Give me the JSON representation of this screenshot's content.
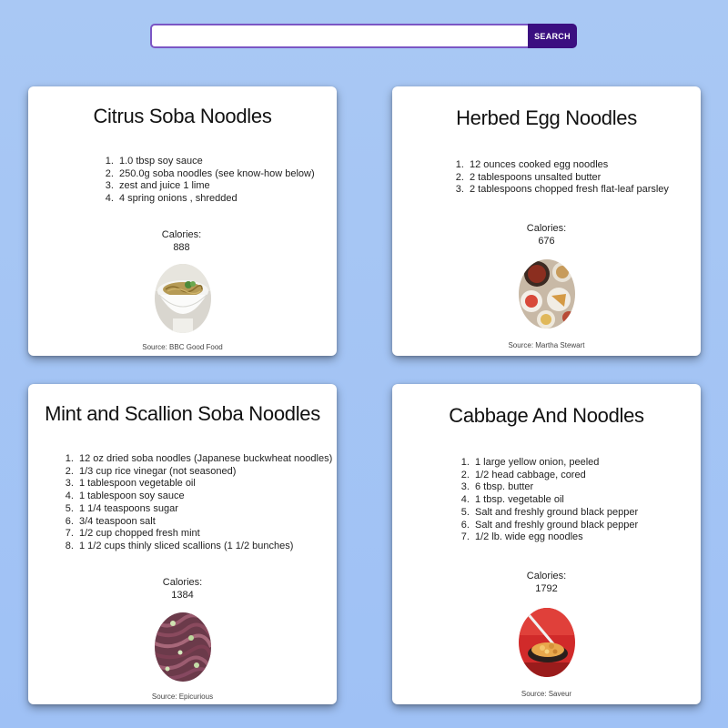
{
  "search": {
    "value": "",
    "placeholder": "",
    "button_label": "SEARCH"
  },
  "cards": [
    {
      "title": "Citrus Soba Noodles",
      "ingredients": [
        "1.0 tbsp soy sauce",
        "250.0g soba noodles (see know-how below)",
        "zest and juice 1 lime",
        "4 spring onions , shredded"
      ],
      "calories_label": "Calories:",
      "calories": "888",
      "source": "Source: BBC Good Food",
      "photo_icon": "noodle-bowl-photo"
    },
    {
      "title": "Herbed Egg Noodles",
      "ingredients": [
        "12 ounces cooked egg noodles",
        "2 tablespoons unsalted butter",
        "2 tablespoons chopped fresh flat-leaf parsley"
      ],
      "calories_label": "Calories:",
      "calories": "676",
      "source": "Source: Martha Stewart",
      "photo_icon": "table-dishes-photo"
    },
    {
      "title": "Mint and Scallion Soba Noodles",
      "ingredients": [
        "12 oz dried soba noodles (Japanese buckwheat noodles)",
        "1/3 cup rice vinegar (not seasoned)",
        "1 tablespoon vegetable oil",
        "1 tablespoon soy sauce",
        "1 1/4 teaspoons sugar",
        "3/4 teaspoon salt",
        "1/2 cup chopped fresh mint",
        "1 1/2 cups thinly sliced scallions (1 1/2 bunches)"
      ],
      "calories_label": "Calories:",
      "calories": "1384",
      "source": "Source: Epicurious",
      "photo_icon": "soba-noodles-photo"
    },
    {
      "title": "Cabbage And Noodles",
      "ingredients": [
        "1 large yellow onion, peeled",
        "1/2 head cabbage, cored",
        "6 tbsp. butter",
        "1 tbsp. vegetable oil",
        "Salt and freshly ground black pepper",
        "Salt and freshly ground black pepper",
        "1/2 lb. wide egg noodles"
      ],
      "calories_label": "Calories:",
      "calories": "1792",
      "source": "Source: Saveur",
      "photo_icon": "cabbage-noodles-photo"
    }
  ]
}
